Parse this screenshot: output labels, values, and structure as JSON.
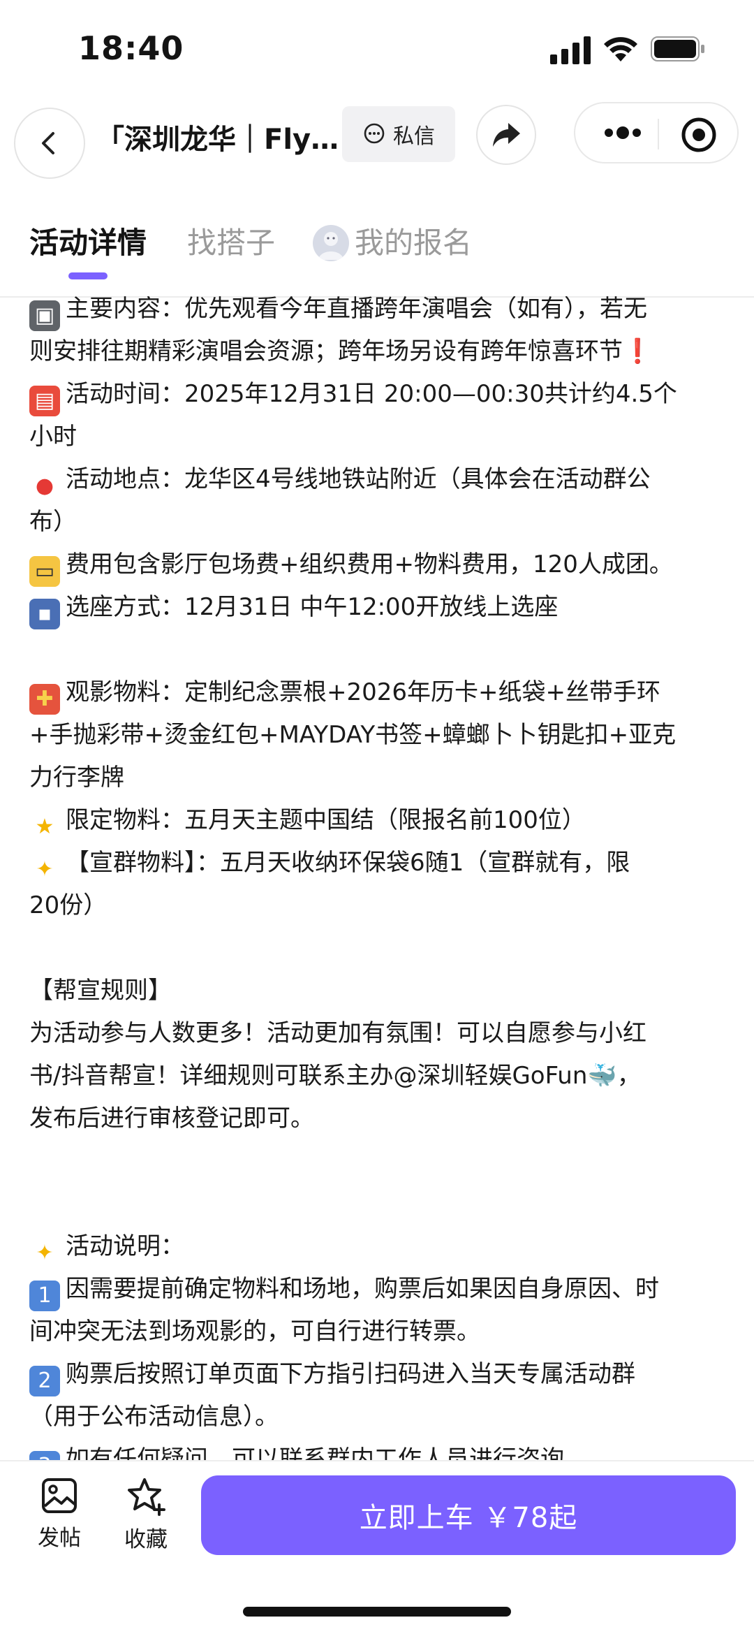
{
  "status_bar": {
    "time": "18:40"
  },
  "nav": {
    "title": "「深圳龙华｜Fly ...",
    "message_label": "私信"
  },
  "tabs": [
    {
      "label": "活动详情"
    },
    {
      "label": "找搭子"
    },
    {
      "label": "我的报名"
    }
  ],
  "content": {
    "lines": [
      {
        "icon": "film-projector-icon",
        "text": "主要内容：优先观看今年直播跨年演唱会（如有），若无"
      },
      {
        "icon": "",
        "text": "则安排往期精彩演唱会资源；跨年场另设有跨年惊喜环节❗"
      },
      {
        "icon": "calendar-icon",
        "text": "活动时间：2025年12月31日 20:00—00:30共计约4.5个"
      },
      {
        "icon": "",
        "text": "小时"
      },
      {
        "icon": "round-pushpin-icon",
        "text": "活动地点：龙华区4号线地铁站附近（具体会在活动群公"
      },
      {
        "icon": "",
        "text": "布）"
      },
      {
        "icon": "ticket-icon",
        "text": "费用包含影厅包场费+组织费用+物料费用，120人成团。"
      },
      {
        "icon": "seat-icon",
        "text": "选座方式：12月31日 中午12:00开放线上选座"
      },
      {
        "icon": "",
        "text": ""
      },
      {
        "icon": "gift-icon",
        "text": "观影物料：定制纪念票根+2026年历卡+纸袋+丝带手环"
      },
      {
        "icon": "",
        "text": "+手抛彩带+烫金红包+MAYDAY书签+蟑螂卜卜钥匙扣+亚克"
      },
      {
        "icon": "",
        "text": "力行李牌"
      },
      {
        "icon": "glowing-star-icon",
        "text": "限定物料：五月天主题中国结（限报名前100位）"
      },
      {
        "icon": "dizzy-icon",
        "text": "【宣群物料】：五月天收纳环保袋6随1（宣群就有，限"
      },
      {
        "icon": "",
        "text": "20份）"
      },
      {
        "icon": "",
        "text": ""
      },
      {
        "icon": "",
        "text": "【帮宣规则】"
      },
      {
        "icon": "",
        "text": "为活动参与人数更多！活动更加有氛围！可以自愿参与小红"
      },
      {
        "icon": "",
        "text": "书/抖音帮宣！详细规则可联系主办@深圳轻娱GoFun🐳，"
      },
      {
        "icon": "",
        "text": "发布后进行审核登记即可。"
      },
      {
        "icon": "",
        "text": ""
      },
      {
        "icon": "",
        "text": ""
      },
      {
        "icon": "dizzy-icon",
        "text": "活动说明："
      },
      {
        "icon": "keycap-1-icon",
        "text": "因需要提前确定物料和场地，购票后如果因自身原因、时"
      },
      {
        "icon": "",
        "text": "间冲突无法到场观影的，可自行进行转票。"
      },
      {
        "icon": "keycap-2-icon",
        "text": "购票后按照订单页面下方指引扫码进入当天专属活动群"
      },
      {
        "icon": "",
        "text": "（用于公布活动信息）。"
      },
      {
        "icon": "keycap-3-icon",
        "text": "如有任何疑问，可以联系群内工作人员进行咨询"
      }
    ]
  },
  "bottom_bar": {
    "post_label": "发帖",
    "favorite_label": "收藏",
    "cta_label": "立即上车 ￥78起"
  },
  "colors": {
    "accent": "#7b61ff",
    "text": "#141414",
    "muted": "#9a9a9a"
  }
}
